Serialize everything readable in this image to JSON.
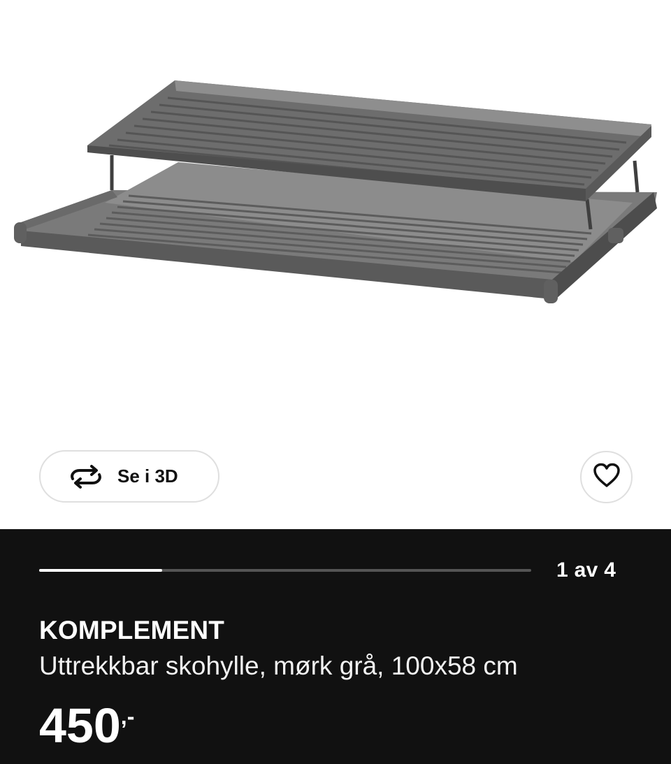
{
  "gallery": {
    "image_alt": "KOMPLEMENT Uttrekkbar skohylle, mørk grå, 100x58 cm",
    "view_3d_label": "Se i 3D",
    "view_3d_icon": "rotate-3d-icon",
    "favorite_icon": "heart-outline-icon"
  },
  "pagination": {
    "text": "1 av 4",
    "current": 1,
    "total": 4,
    "progress_fraction": 0.25
  },
  "product": {
    "name": "KOMPLEMENT",
    "description": "Uttrekkbar skohylle, mørk grå, 100x58 cm",
    "price_integer": "450",
    "price_decimals": ",-"
  },
  "colors": {
    "info_background": "#111111",
    "text": "#ffffff",
    "progress_track": "#555555",
    "progress_fill": "#ffffff",
    "shelf_metal": "#6e6e6e"
  }
}
